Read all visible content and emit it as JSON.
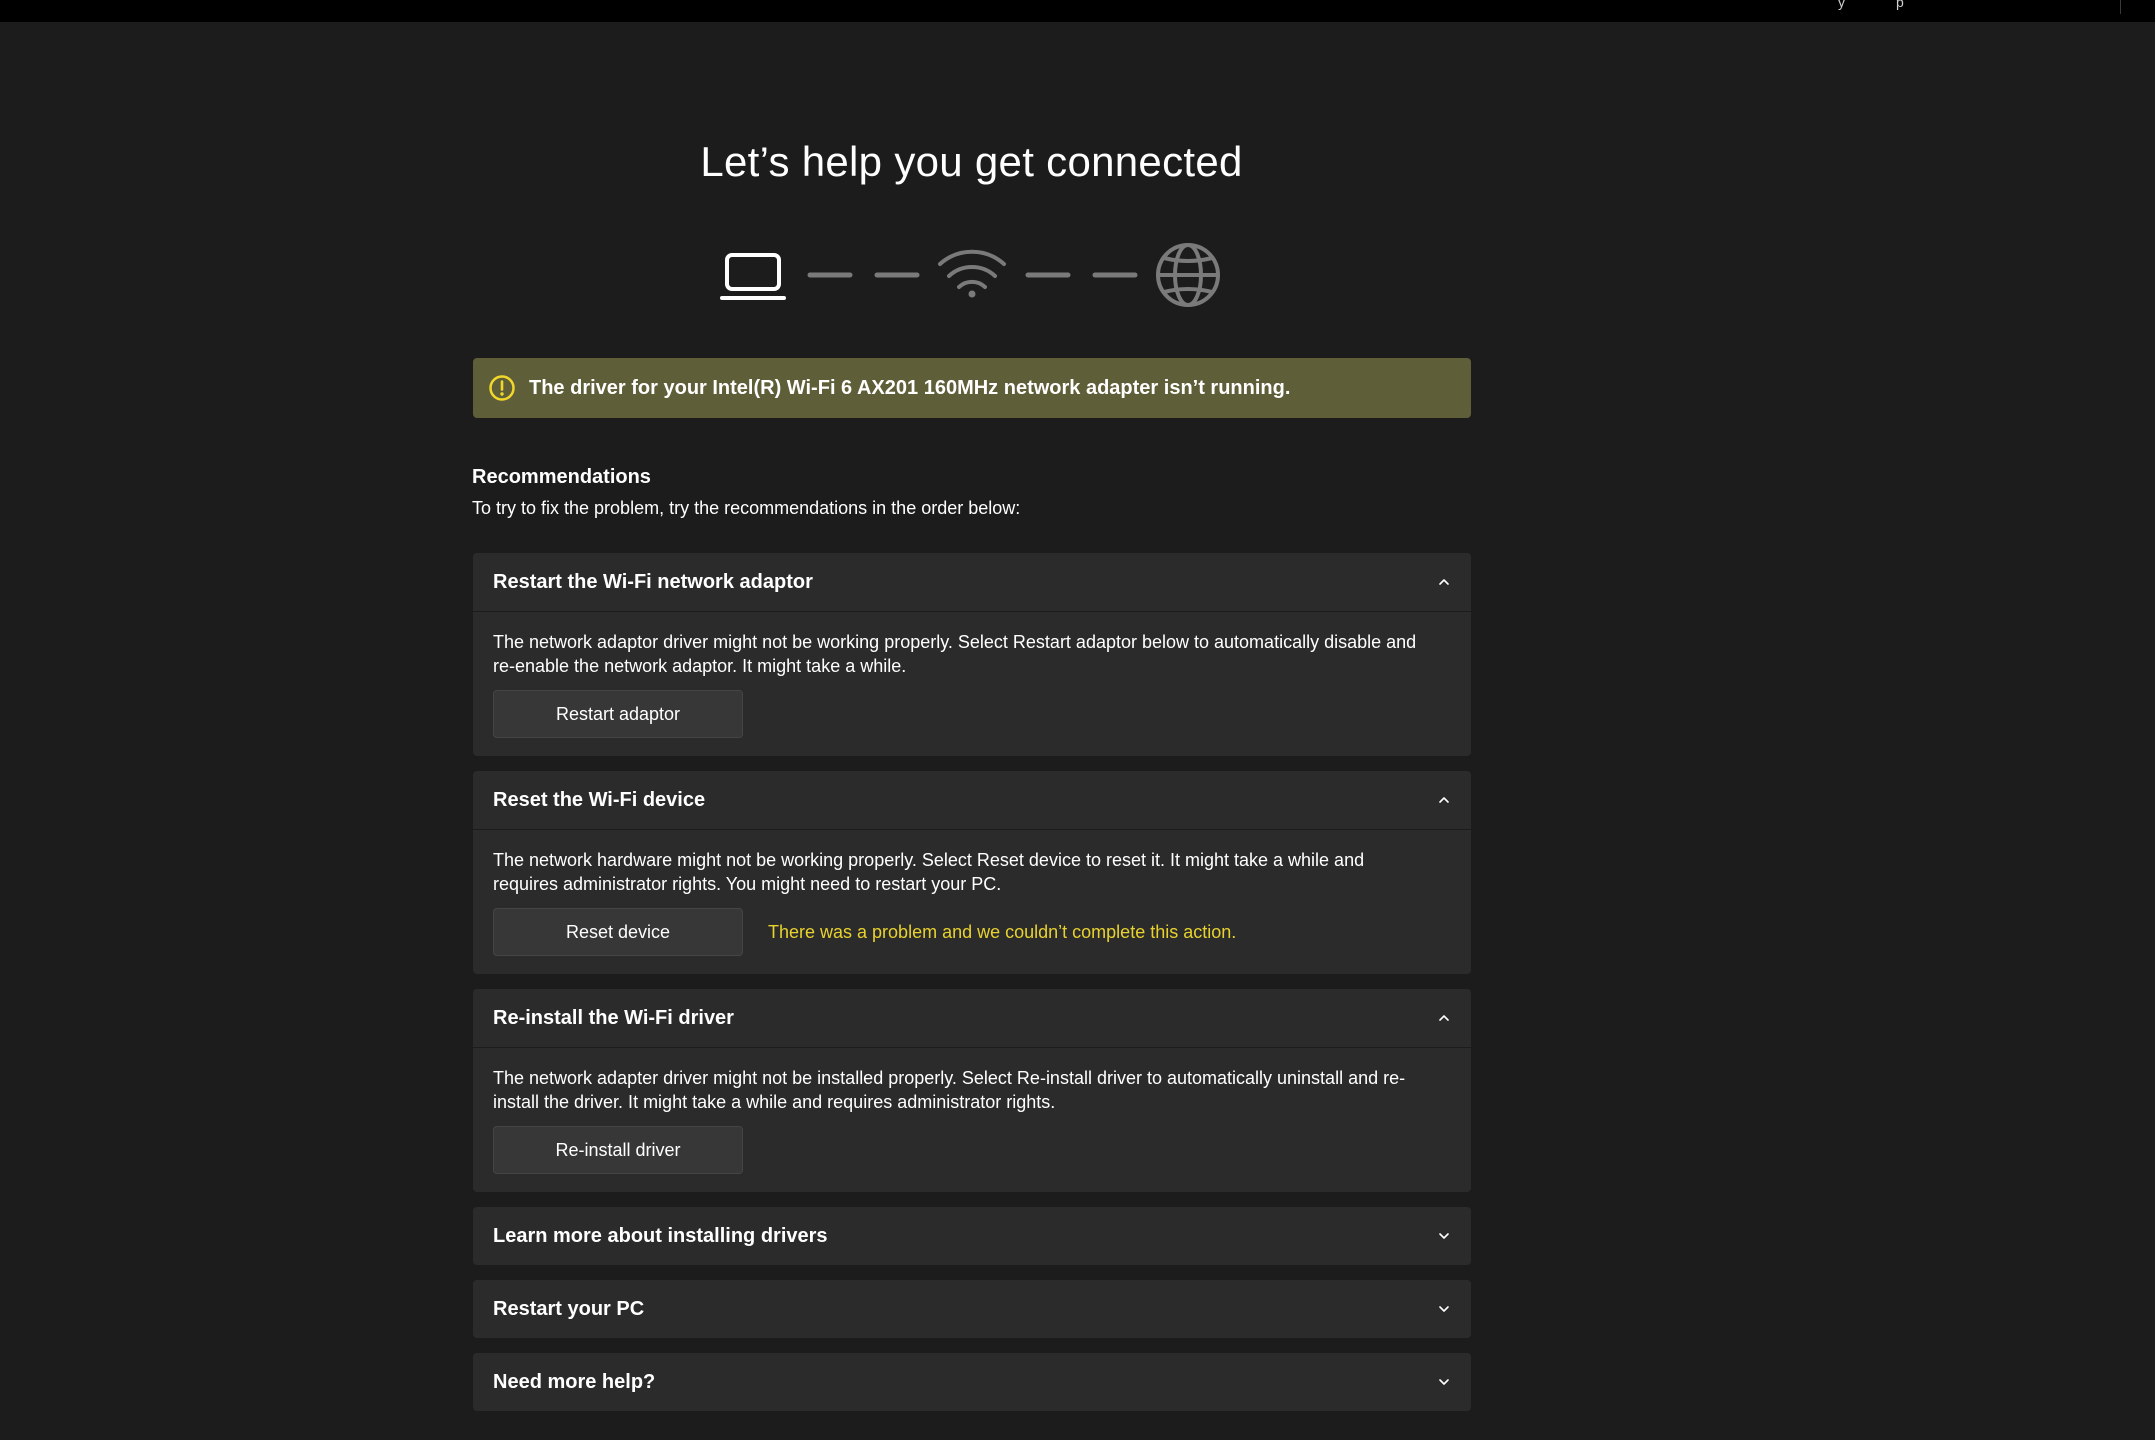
{
  "top_bar": {
    "fragment_a": "y",
    "fragment_b": "p"
  },
  "page": {
    "title": "Let’s help you get connected"
  },
  "connection_graphic": {
    "icons": [
      "laptop-icon",
      "wifi-icon",
      "globe-icon"
    ],
    "status_color": "#ffffff",
    "inactive_color": "#7a7a7a"
  },
  "alert": {
    "icon": "warning-circle-icon",
    "color": "#5e5e38",
    "icon_color": "#f2d72b",
    "text": "The driver for your Intel(R) Wi-Fi 6 AX201 160MHz network adapter isn’t running."
  },
  "recommendations": {
    "heading": "Recommendations",
    "subtitle": "To try to fix the problem, try the recommendations in the order below:"
  },
  "cards": [
    {
      "title": "Restart the Wi-Fi network adaptor",
      "expanded": true,
      "description": "The network adaptor driver might not be working properly. Select Restart adaptor below to automatically disable and re-enable the network adaptor. It might take a while.",
      "button_label": "Restart adaptor",
      "error": ""
    },
    {
      "title": "Reset the Wi-Fi device",
      "expanded": true,
      "description": "The network hardware might not be working properly. Select Reset device to reset it. It might take a while and requires administrator rights. You might need to restart your PC.",
      "button_label": "Reset device",
      "error": "There was a problem and we couldn’t complete this action."
    },
    {
      "title": "Re-install the Wi-Fi driver",
      "expanded": true,
      "description": "The network adapter driver might not be installed properly. Select Re-install driver to automatically uninstall and re-install the driver. It might take a while and requires administrator rights.",
      "button_label": "Re-install driver",
      "error": ""
    },
    {
      "title": "Learn more about installing drivers",
      "expanded": false
    },
    {
      "title": "Restart your PC",
      "expanded": false
    },
    {
      "title": "Need more help?",
      "expanded": false
    }
  ],
  "colors": {
    "background": "#1c1c1c",
    "card": "#2b2b2b",
    "error_text": "#e8d22e"
  }
}
